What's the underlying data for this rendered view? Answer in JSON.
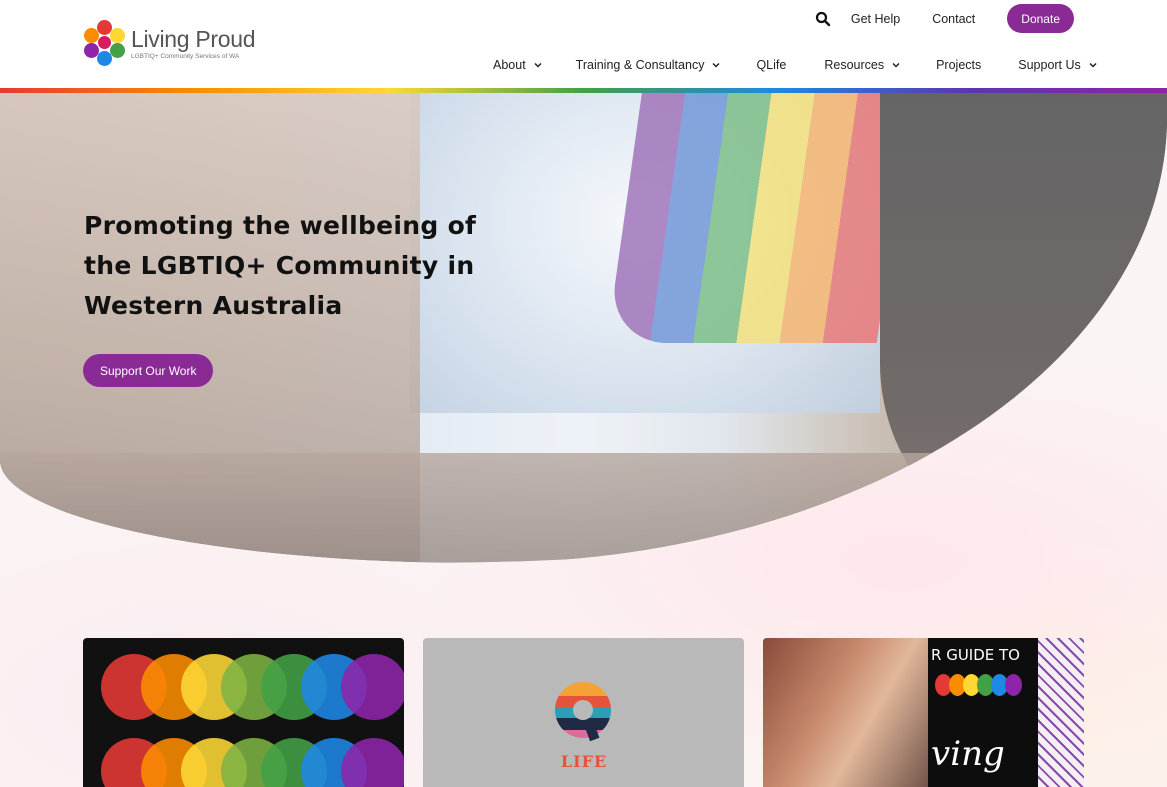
{
  "brand": {
    "name": "Living Proud",
    "tagline": "LGBTIQ+ Community Services of WA",
    "accent": "#8a2b95"
  },
  "top_links": {
    "search_icon": "search-icon",
    "get_help": "Get Help",
    "contact": "Contact",
    "donate": "Donate"
  },
  "nav": [
    {
      "label": "About",
      "dropdown": true
    },
    {
      "label": "Training & Consultancy",
      "dropdown": true
    },
    {
      "label": "QLife",
      "dropdown": false
    },
    {
      "label": "Resources",
      "dropdown": true
    },
    {
      "label": "Projects",
      "dropdown": false
    },
    {
      "label": "Support Us",
      "dropdown": true
    }
  ],
  "hero": {
    "title_part1": "Promoting the wellbeing of the ",
    "title_bold": "LGBTIQ+ Community",
    "title_part2": " in Western Australia",
    "cta": "Support Our Work"
  },
  "cards": [
    {
      "name": "rainbow-circles"
    },
    {
      "name": "qlife",
      "logo_text": "LIFE"
    },
    {
      "name": "guide",
      "poster_text": "R GUIDE TO",
      "script_text": "ving"
    }
  ]
}
